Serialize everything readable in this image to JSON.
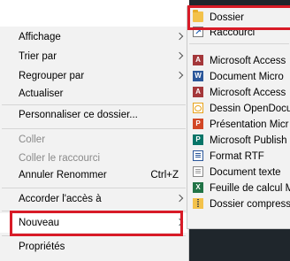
{
  "context_menu": {
    "items": [
      {
        "label": "Affichage",
        "shortcut": "",
        "submenu": true,
        "disabled": false
      },
      {
        "label": "Trier par",
        "shortcut": "",
        "submenu": true,
        "disabled": false
      },
      {
        "label": "Regrouper par",
        "shortcut": "",
        "submenu": true,
        "disabled": false
      },
      {
        "label": "Actualiser",
        "shortcut": "",
        "submenu": false,
        "disabled": false
      },
      {
        "label": "Personnaliser ce dossier...",
        "shortcut": "",
        "submenu": false,
        "disabled": false
      },
      {
        "label": "Coller",
        "shortcut": "",
        "submenu": false,
        "disabled": true
      },
      {
        "label": "Coller le raccourci",
        "shortcut": "",
        "submenu": false,
        "disabled": true
      },
      {
        "label": "Annuler Renommer",
        "shortcut": "Ctrl+Z",
        "submenu": false,
        "disabled": false
      },
      {
        "label": "Accorder l'accès à",
        "shortcut": "",
        "submenu": true,
        "disabled": false
      },
      {
        "label": "Nouveau",
        "shortcut": "",
        "submenu": true,
        "disabled": false,
        "active": true
      },
      {
        "label": "Propriétés",
        "shortcut": "",
        "submenu": false,
        "disabled": false
      }
    ]
  },
  "new_submenu": {
    "items": [
      {
        "label": "Dossier",
        "icon": "folder-icon"
      },
      {
        "label": "Raccourci",
        "icon": "shortcut-icon"
      },
      {
        "label": "Microsoft Access",
        "icon": "access-icon"
      },
      {
        "label": "Document Micro",
        "icon": "word-icon"
      },
      {
        "label": "Microsoft Access",
        "icon": "access-icon"
      },
      {
        "label": "Dessin OpenDocu",
        "icon": "opendocument-drawing-icon"
      },
      {
        "label": "Présentation Micr",
        "icon": "powerpoint-icon"
      },
      {
        "label": "Microsoft Publish",
        "icon": "publisher-icon"
      },
      {
        "label": "Format RTF",
        "icon": "rtf-icon"
      },
      {
        "label": "Document texte",
        "icon": "text-document-icon"
      },
      {
        "label": "Feuille de calcul M",
        "icon": "excel-icon"
      },
      {
        "label": "Dossier compress",
        "icon": "zip-folder-icon"
      }
    ]
  },
  "icon_letters": {
    "access": "A",
    "word": "W",
    "ppt": "P",
    "pub": "P",
    "xls": "X"
  },
  "colors": {
    "highlight_box": "#d81b27",
    "menu_bg": "#f2f2f2",
    "disabled_text": "#8a8a8a"
  }
}
